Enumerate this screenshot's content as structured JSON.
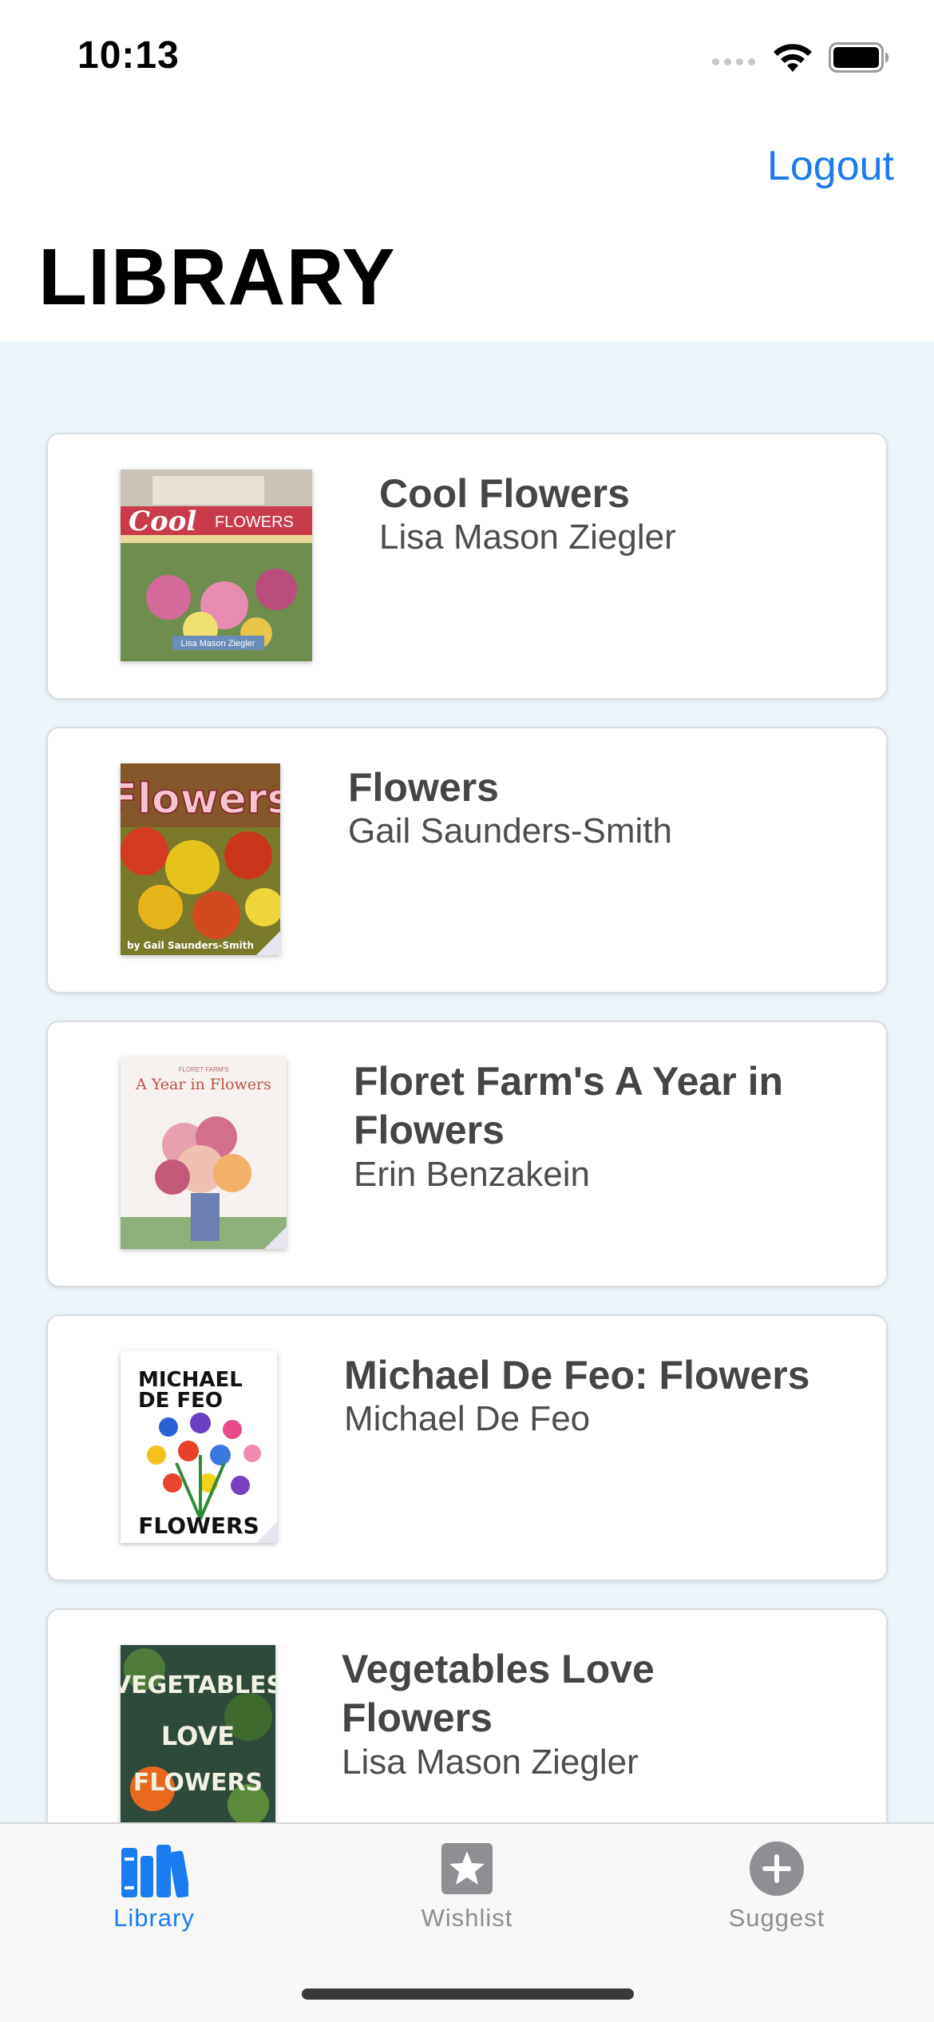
{
  "status_bar": {
    "time": "10:13"
  },
  "header": {
    "logout_label": "Logout",
    "title": "LIBRARY"
  },
  "books": [
    {
      "title": "Cool Flowers",
      "author": "Lisa Mason Ziegler",
      "cover_title": "Cool",
      "cover_title2": "FLOWERS",
      "cover_author": "Lisa Mason Ziegler"
    },
    {
      "title": "Flowers",
      "author": "Gail Saunders-Smith",
      "cover_title": "Flowers",
      "cover_author": "by Gail Saunders-Smith"
    },
    {
      "title": "Floret Farm's A Year in Flowers",
      "author": "Erin Benzakein",
      "cover_small": "FLORET FARM'S",
      "cover_title": "A Year in Flowers"
    },
    {
      "title": "Michael De Feo: Flowers",
      "author": "Michael De Feo",
      "cover_top": "MICHAEL",
      "cover_top2": "DE FEO",
      "cover_bottom": "FLOWERS"
    },
    {
      "title": "Vegetables Love Flowers",
      "author": "Lisa Mason Ziegler",
      "cover_line1": "VEGETABLES",
      "cover_line2": "LOVE",
      "cover_line3": "FLOWERS"
    }
  ],
  "tabs": [
    {
      "label": "Library",
      "icon": "library-icon",
      "active": true
    },
    {
      "label": "Wishlist",
      "icon": "star-icon",
      "active": false
    },
    {
      "label": "Suggest",
      "icon": "plus-icon",
      "active": false
    }
  ],
  "colors": {
    "accent": "#1a7cf0",
    "background": "#eaf4f9",
    "inactive_tab": "#8e8e93"
  }
}
